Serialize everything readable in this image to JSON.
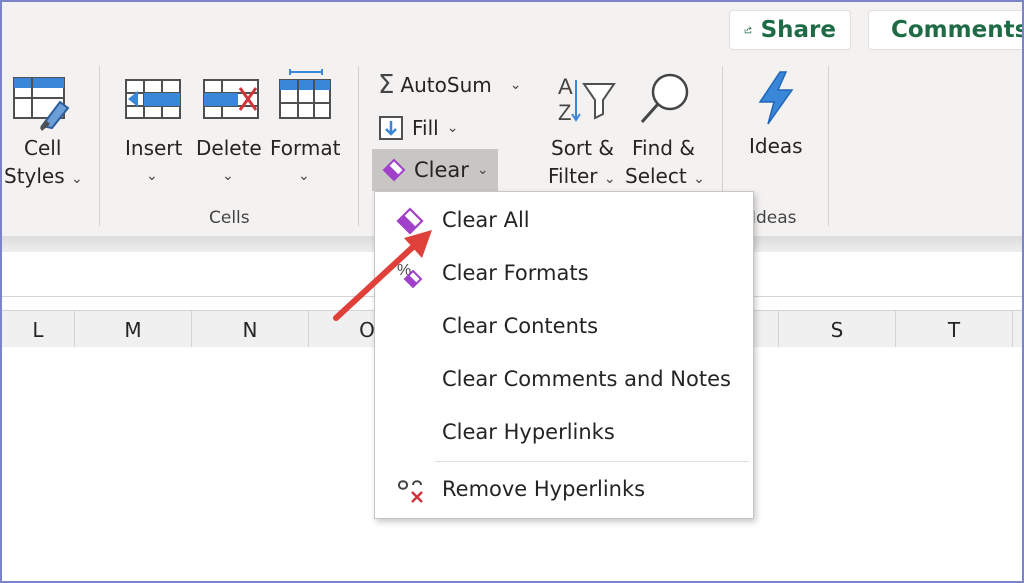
{
  "header": {
    "share_label": "Share",
    "comments_label": "Comments"
  },
  "ribbon": {
    "cell_styles": {
      "line1": "Cell",
      "line2": "Styles"
    },
    "cells": {
      "insert_label": "Insert",
      "delete_label": "Delete",
      "format_label": "Format",
      "group_label": "Cells"
    },
    "editing": {
      "autosum_label": "AutoSum",
      "fill_label": "Fill",
      "clear_label": "Clear",
      "sort_line1": "Sort &",
      "sort_line2": "Filter",
      "find_line1": "Find &",
      "find_line2": "Select"
    },
    "ideas": {
      "label": "Ideas",
      "group_label": "Ideas"
    }
  },
  "columns": [
    "L",
    "M",
    "N",
    "O",
    "S",
    "T"
  ],
  "clear_menu": {
    "items": [
      {
        "label": "Clear All",
        "icon": "eraser-icon"
      },
      {
        "label": "Clear Formats",
        "icon": "clear-formats-icon"
      },
      {
        "label": "Clear Contents",
        "icon": ""
      },
      {
        "label": "Clear Comments and Notes",
        "icon": ""
      },
      {
        "label": "Clear Hyperlinks",
        "icon": ""
      },
      {
        "label": "Remove Hyperlinks",
        "icon": "remove-link-icon"
      }
    ]
  },
  "colors": {
    "accent_purple": "#a140c8",
    "excel_green": "#1e6b46",
    "arrow_red": "#e0403a",
    "ribbon_bg": "#f3f2f1"
  }
}
